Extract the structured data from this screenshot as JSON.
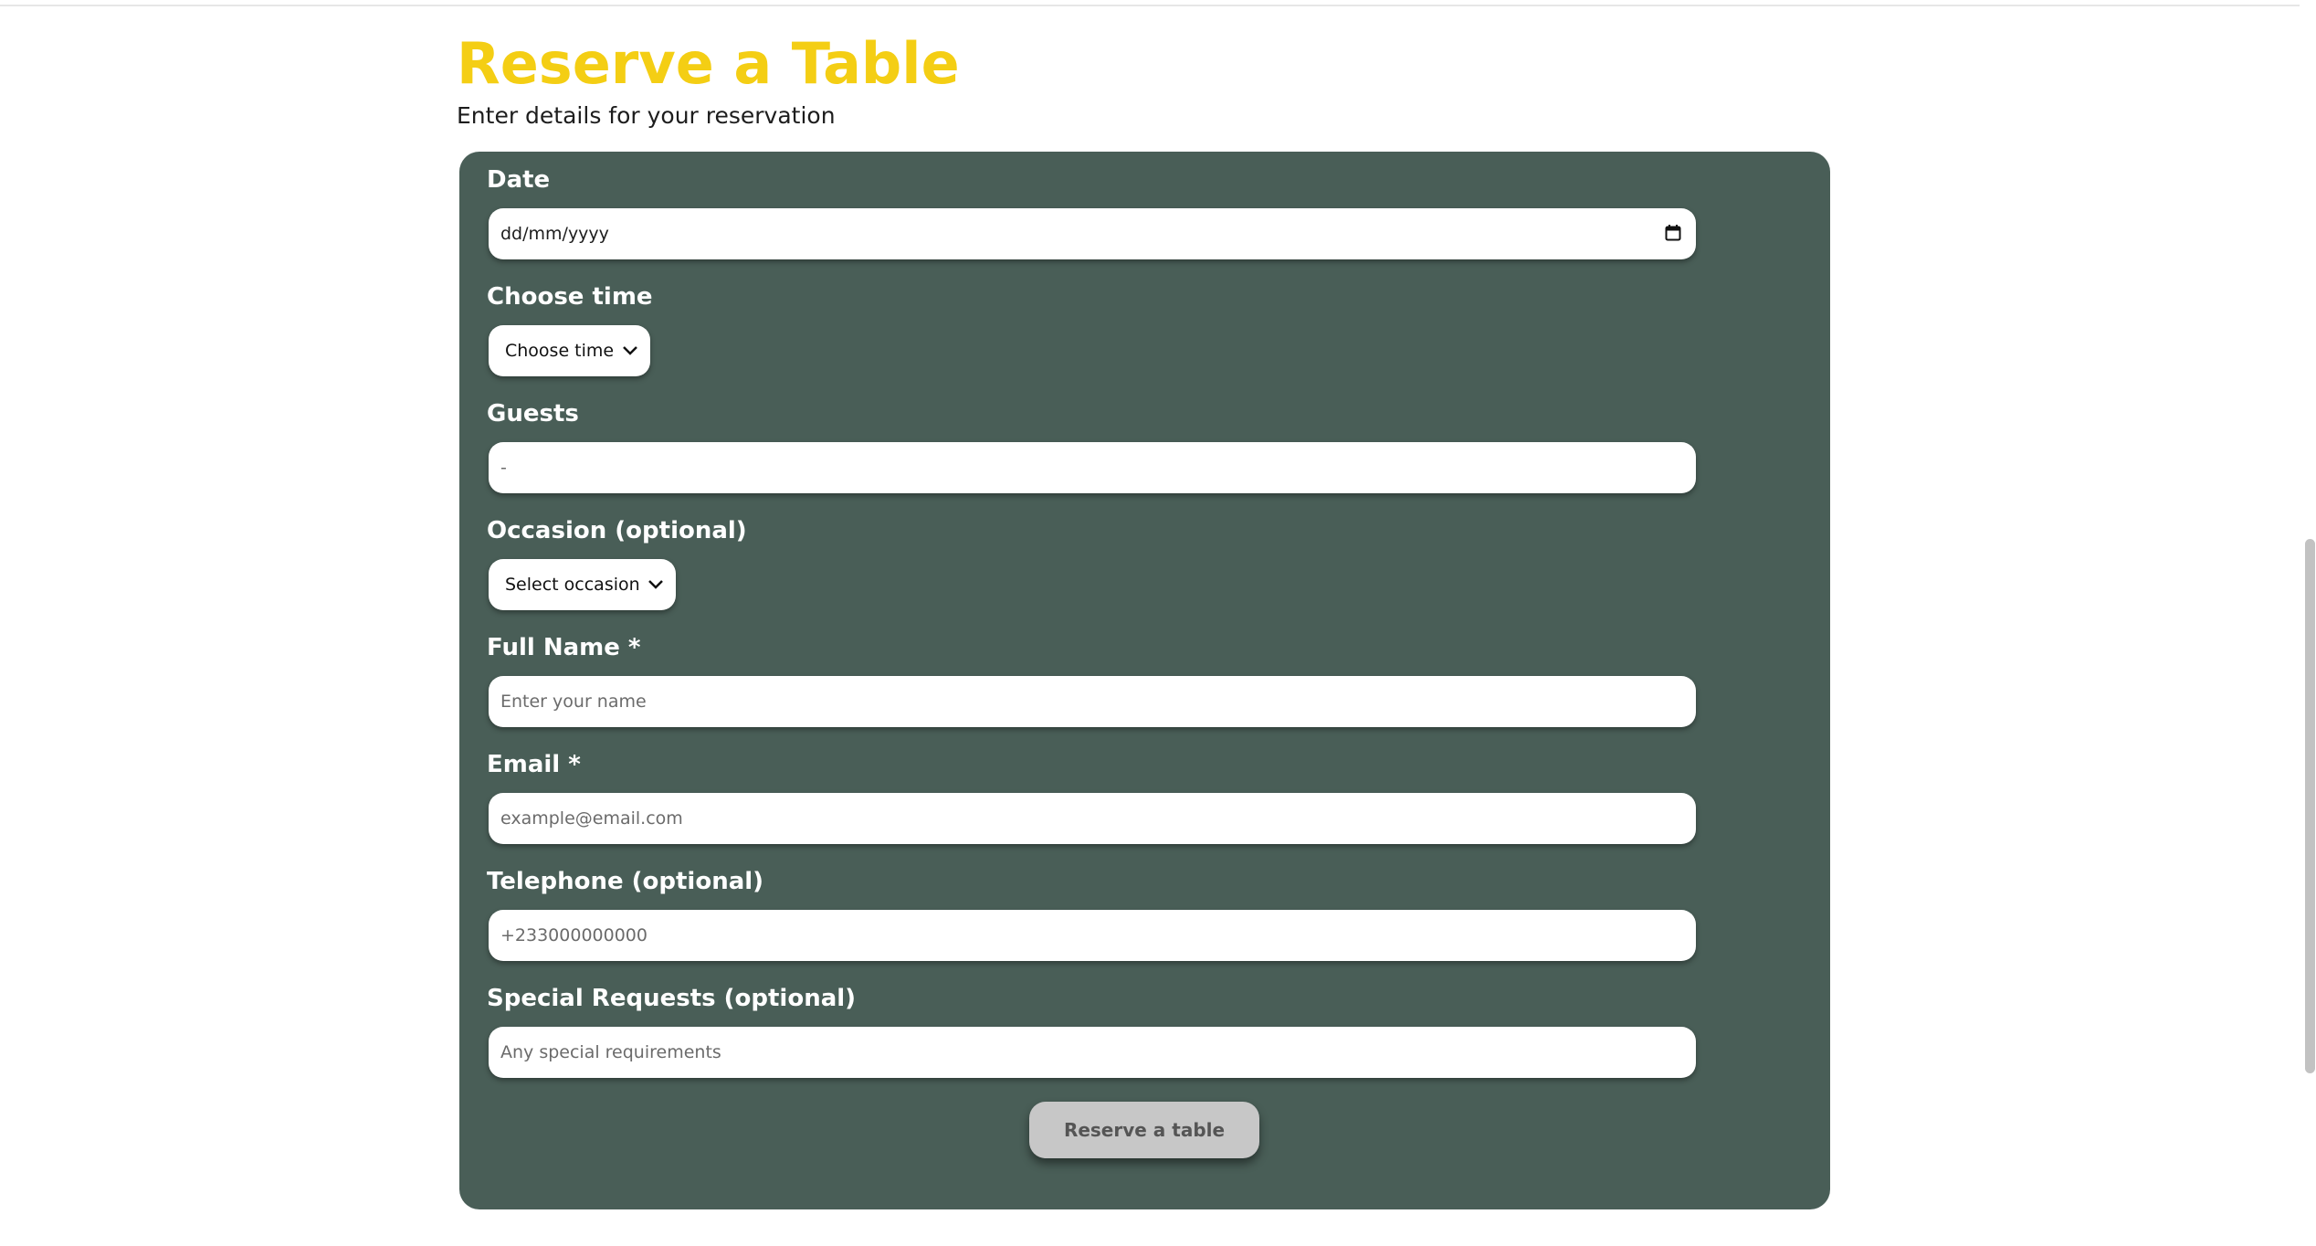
{
  "header": {
    "title": "Reserve a Table",
    "subtitle": "Enter details for your reservation"
  },
  "colors": {
    "accent_yellow": "#f4ce14",
    "card_green": "#495e57",
    "button_grey": "#c7c7c7"
  },
  "form": {
    "date": {
      "label": "Date",
      "value": "dd/mm/yyyy",
      "icon": "calendar-icon"
    },
    "time": {
      "label": "Choose time",
      "selected": "Choose time",
      "icon": "chevron-down-icon"
    },
    "guests": {
      "label": "Guests",
      "value": "-"
    },
    "occasion": {
      "label": "Occasion (optional)",
      "selected": "Select occasion",
      "icon": "chevron-down-icon"
    },
    "full_name": {
      "label": "Full Name *",
      "placeholder": "Enter your name"
    },
    "email": {
      "label": "Email *",
      "placeholder": "example@email.com"
    },
    "telephone": {
      "label": "Telephone (optional)",
      "placeholder": "+233000000000"
    },
    "special_requests": {
      "label": "Special Requests (optional)",
      "placeholder": "Any special requirements"
    },
    "submit_label": "Reserve a table"
  }
}
